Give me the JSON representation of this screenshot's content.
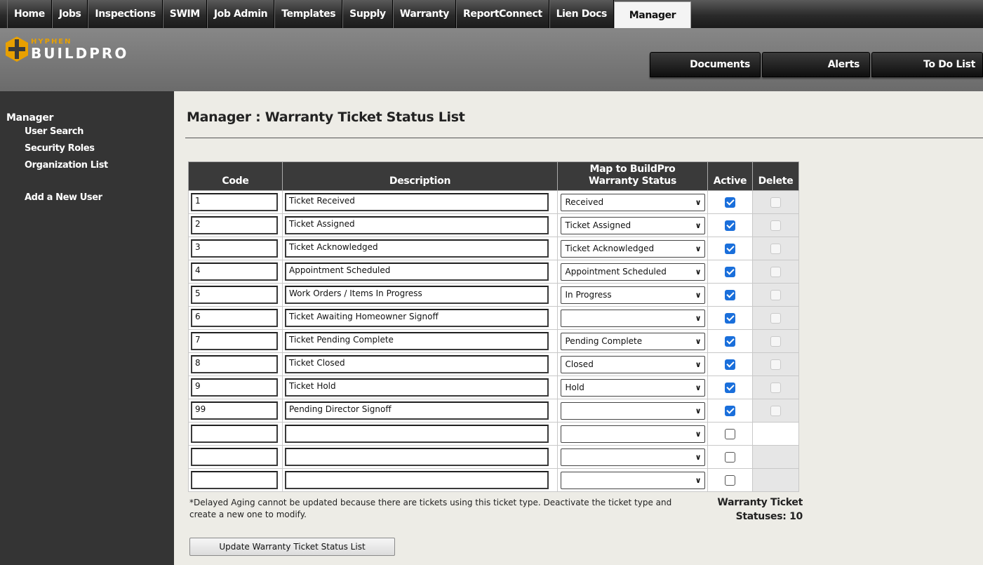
{
  "nav": {
    "tabs": [
      "Home",
      "Jobs",
      "Inspections",
      "SWIM",
      "Job Admin",
      "Templates",
      "Supply",
      "Warranty",
      "ReportConnect",
      "Lien Docs",
      "Manager"
    ],
    "active": "Manager"
  },
  "logo": {
    "line1": "HYPHEN",
    "line2": "BUILDPRO",
    "accent": "#e8a000"
  },
  "header_buttons": {
    "documents": "Documents",
    "alerts": "Alerts",
    "todo": "To Do List"
  },
  "sidebar": {
    "title": "Manager",
    "links": [
      "User Search",
      "Security Roles",
      "Organization List"
    ],
    "add_user": "Add a New User"
  },
  "page": {
    "title": "Manager : Warranty Ticket Status List"
  },
  "table": {
    "headers": {
      "code": "Code",
      "description": "Description",
      "map_line1": "Map to BuildPro",
      "map_line2": "Warranty Status",
      "active": "Active",
      "delete": "Delete"
    },
    "rows": [
      {
        "code": "1",
        "description": "Ticket Received",
        "map": "Received",
        "active": true
      },
      {
        "code": "2",
        "description": "Ticket Assigned",
        "map": "Ticket Assigned",
        "active": true
      },
      {
        "code": "3",
        "description": "Ticket Acknowledged",
        "map": "Ticket Acknowledged",
        "active": true
      },
      {
        "code": "4",
        "description": "Appointment Scheduled",
        "map": "Appointment Scheduled",
        "active": true
      },
      {
        "code": "5",
        "description": "Work Orders / Items In Progress",
        "map": "In Progress",
        "active": true
      },
      {
        "code": "6",
        "description": "Ticket Awaiting Homeowner Signoff",
        "map": "",
        "active": true
      },
      {
        "code": "7",
        "description": "Ticket Pending Complete",
        "map": "Pending Complete",
        "active": true
      },
      {
        "code": "8",
        "description": "Ticket Closed",
        "map": "Closed",
        "active": true
      },
      {
        "code": "9",
        "description": "Ticket Hold",
        "map": "Hold",
        "active": true
      },
      {
        "code": "99",
        "description": "Pending Director Signoff",
        "map": "",
        "active": true
      },
      {
        "code": "",
        "description": "",
        "map": "",
        "active": false
      },
      {
        "code": "",
        "description": "",
        "map": "",
        "active": false
      },
      {
        "code": "",
        "description": "",
        "map": "",
        "active": false
      }
    ]
  },
  "note": "*Delayed Aging cannot be updated because there are tickets using this ticket type. Deactivate the ticket type and create a new one to modify.",
  "count": {
    "label_line1": "Warranty Ticket",
    "label_line2": "Statuses:",
    "value": "10"
  },
  "update_button": "Update Warranty Ticket Status List",
  "colors": {
    "checkbox_checked": "#1a6fdb",
    "sidebar_bg": "#343434",
    "page_bg": "#edece6"
  }
}
